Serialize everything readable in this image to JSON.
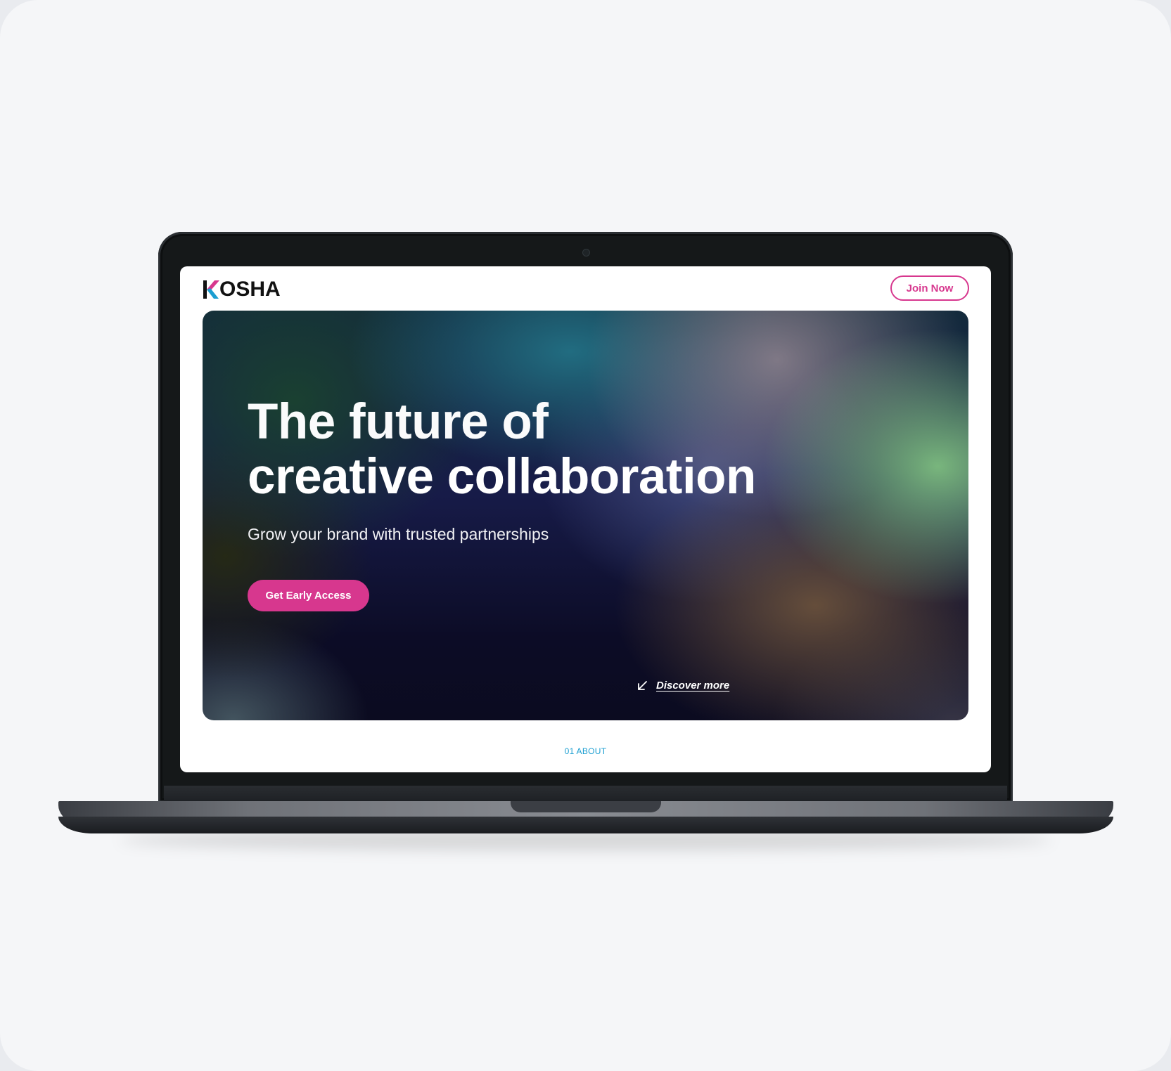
{
  "brand": {
    "name": "KOSHA",
    "logo_mark_text": "OSHA",
    "colors": {
      "accent_pink": "#d7378e",
      "accent_blue": "#1b9ed1",
      "text_dark": "#121212"
    }
  },
  "header": {
    "join_button_label": "Join Now"
  },
  "hero": {
    "title_line1": "The future of",
    "title_line2": "creative collaboration",
    "subtitle": "Grow your brand with trusted partnerships",
    "cta_label": "Get Early Access",
    "discover_label": "Discover more",
    "discover_icon": "arrow-down-left-icon"
  },
  "sections": {
    "next_label": "01 ABOUT"
  },
  "device": {
    "frame": "laptop",
    "icons": [
      "camera-icon"
    ]
  }
}
